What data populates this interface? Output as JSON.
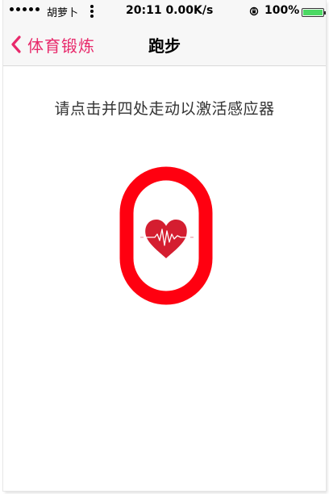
{
  "status_bar": {
    "carrier": "胡萝卜",
    "time_speed": "20:11 0.00K/s",
    "battery_percent": "100%",
    "battery_level": 1.0,
    "battery_color": "#4cd964"
  },
  "nav": {
    "back_label": "体育锻炼",
    "title": "跑步",
    "accent_color": "#e8296b"
  },
  "content": {
    "instruction": "请点击并四处走动以激活感应器",
    "sensor_ring_color": "#ff0010",
    "heart_color": "#d41e30",
    "sensor_icon": "heart-pulse-icon"
  }
}
